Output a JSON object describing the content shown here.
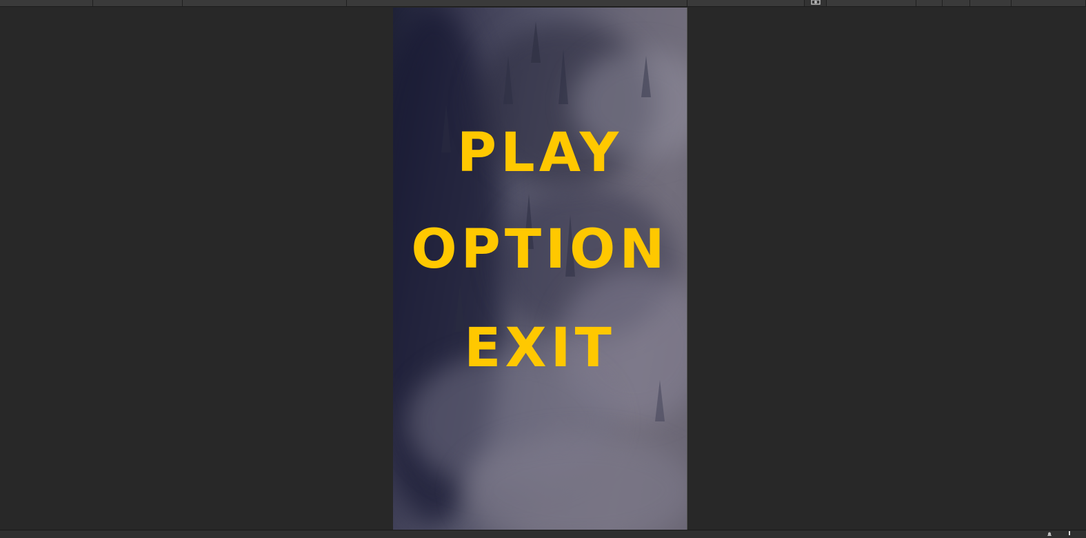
{
  "menu": {
    "items": [
      "PLAY",
      "OPTION",
      "EXIT"
    ]
  },
  "colors": {
    "menu_text": "#ffc800",
    "editor_background": "#282828",
    "toolbar": "#3a3a3a"
  },
  "icons": {
    "toolbar": "camera-icon",
    "status_bar": [
      "bell-icon",
      "alert-icon"
    ]
  }
}
